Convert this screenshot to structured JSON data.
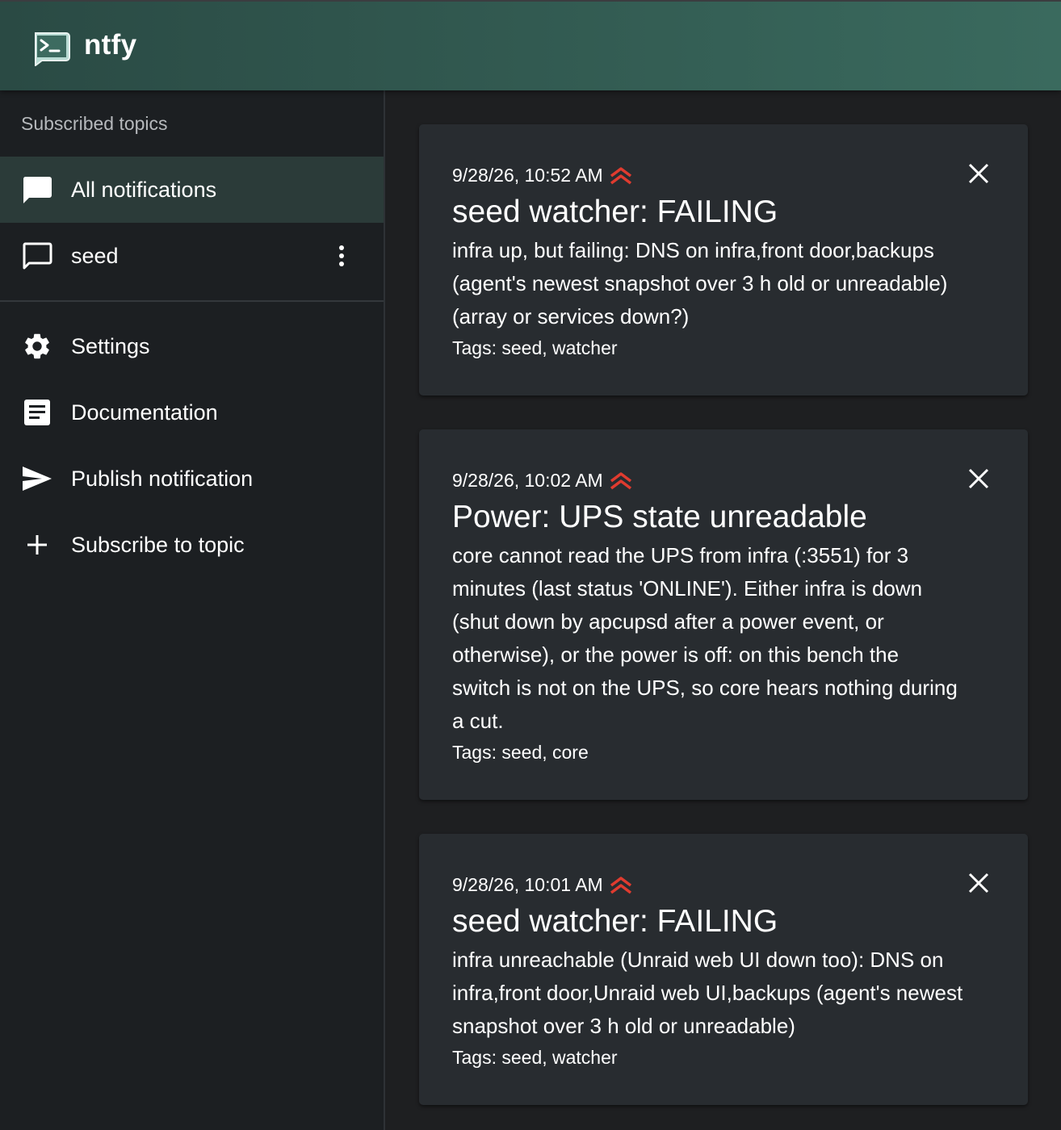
{
  "app": {
    "title": "ntfy",
    "logo_icon": "terminal-logo-icon"
  },
  "colors": {
    "appbar_start": "#2a4a44",
    "appbar_end": "#3a6a5e",
    "selected_item_bg": "#2b3b39",
    "priority_red": "#e03b2f",
    "card_bg": "#282c30",
    "sidebar_bg": "#1c1f22"
  },
  "sidebar": {
    "heading": "Subscribed topics",
    "topics": [
      {
        "label": "All notifications",
        "icon": "chat-bubble-filled-icon",
        "selected": true
      },
      {
        "label": "seed",
        "icon": "chat-bubble-outline-icon",
        "selected": false,
        "menu_icon": "more-vert-icon"
      }
    ],
    "actions": [
      {
        "label": "Settings",
        "icon": "gear-icon"
      },
      {
        "label": "Documentation",
        "icon": "document-icon"
      },
      {
        "label": "Publish notification",
        "icon": "send-icon"
      },
      {
        "label": "Subscribe to topic",
        "icon": "plus-icon"
      }
    ]
  },
  "notifications": [
    {
      "date": "9/28/26, 10:52 AM",
      "priority_icon": "priority-high-icon",
      "title": "seed watcher: FAILING",
      "message_lines": [
        "infra up, but failing: DNS on infra,front door,backups",
        "(agent's newest snapshot over 3 h old or unreadable)",
        "(array or services down?)"
      ],
      "tags": "Tags: seed, watcher"
    },
    {
      "date": "9/28/26, 10:02 AM",
      "priority_icon": "priority-high-icon",
      "title": "Power: UPS state unreadable",
      "message_lines": [
        "core cannot read the UPS from infra (:3551) for 3",
        "minutes (last status 'ONLINE'). Either infra is down",
        "(shut down by apcupsd after a power event, or",
        "otherwise), or the power is off: on this bench the",
        "switch is not on the UPS, so core hears nothing during",
        "a cut."
      ],
      "tags": "Tags: seed, core"
    },
    {
      "date": "9/28/26, 10:01 AM",
      "priority_icon": "priority-high-icon",
      "title": "seed watcher: FAILING",
      "message_lines": [
        "infra unreachable (Unraid web UI down too): DNS on",
        "infra,front door,Unraid web UI,backups (agent's newest",
        "snapshot over 3 h old or unreadable)"
      ],
      "tags": "Tags: seed, watcher"
    }
  ]
}
